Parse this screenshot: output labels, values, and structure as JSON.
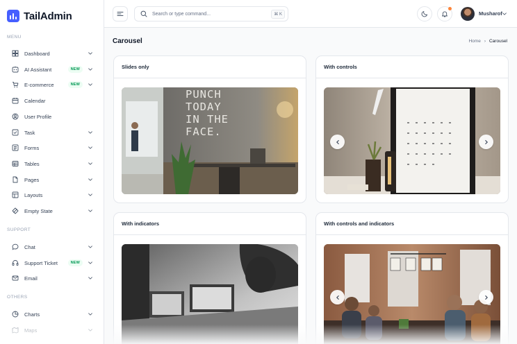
{
  "app": {
    "name": "TailAdmin"
  },
  "sidebar": {
    "sections": [
      "MENU",
      "SUPPORT",
      "OTHERS"
    ],
    "items": [
      {
        "label": "Dashboard",
        "icon": "grid-icon",
        "chevron": true
      },
      {
        "label": "AI Assistant",
        "icon": "ai-icon",
        "badge": "NEW",
        "chevron": true
      },
      {
        "label": "E-commerce",
        "icon": "cart-icon",
        "badge": "NEW",
        "chevron": true
      },
      {
        "label": "Calendar",
        "icon": "calendar-icon"
      },
      {
        "label": "User Profile",
        "icon": "user-icon"
      },
      {
        "label": "Task",
        "icon": "task-icon",
        "chevron": true
      },
      {
        "label": "Forms",
        "icon": "forms-icon",
        "chevron": true
      },
      {
        "label": "Tables",
        "icon": "table-icon",
        "chevron": true
      },
      {
        "label": "Pages",
        "icon": "pages-icon",
        "chevron": true
      },
      {
        "label": "Layouts",
        "icon": "layout-icon",
        "chevron": true
      },
      {
        "label": "Empty State",
        "icon": "empty-state-icon",
        "chevron": true
      },
      {
        "label": "Chat",
        "icon": "chat-icon",
        "chevron": true
      },
      {
        "label": "Support Ticket",
        "icon": "headset-icon",
        "badge": "NEW",
        "chevron": true
      },
      {
        "label": "Email",
        "icon": "mail-icon",
        "chevron": true
      },
      {
        "label": "Charts",
        "icon": "pie-chart-icon",
        "chevron": true
      },
      {
        "label": "Maps",
        "icon": "map-icon",
        "chevron": true
      }
    ]
  },
  "header": {
    "search_placeholder": "Search or type command...",
    "shortcut": "⌘ K",
    "user_name": "Musharof"
  },
  "page": {
    "title": "Carousel",
    "breadcrumb": {
      "home": "Home",
      "separator": "›",
      "current": "Carousel"
    }
  },
  "cards": [
    {
      "title": "Slides only",
      "controls": false
    },
    {
      "title": "With controls",
      "controls": true
    },
    {
      "title": "With indicators",
      "controls": false
    },
    {
      "title": "With controls and indicators",
      "controls": true
    }
  ],
  "slides": {
    "card1_wall_text": "PUNCH\nTODAY\nIN THE\nFACE."
  },
  "colors": {
    "accent": "#465fff",
    "badge_green": "#039855",
    "notification": "#fd853a"
  }
}
